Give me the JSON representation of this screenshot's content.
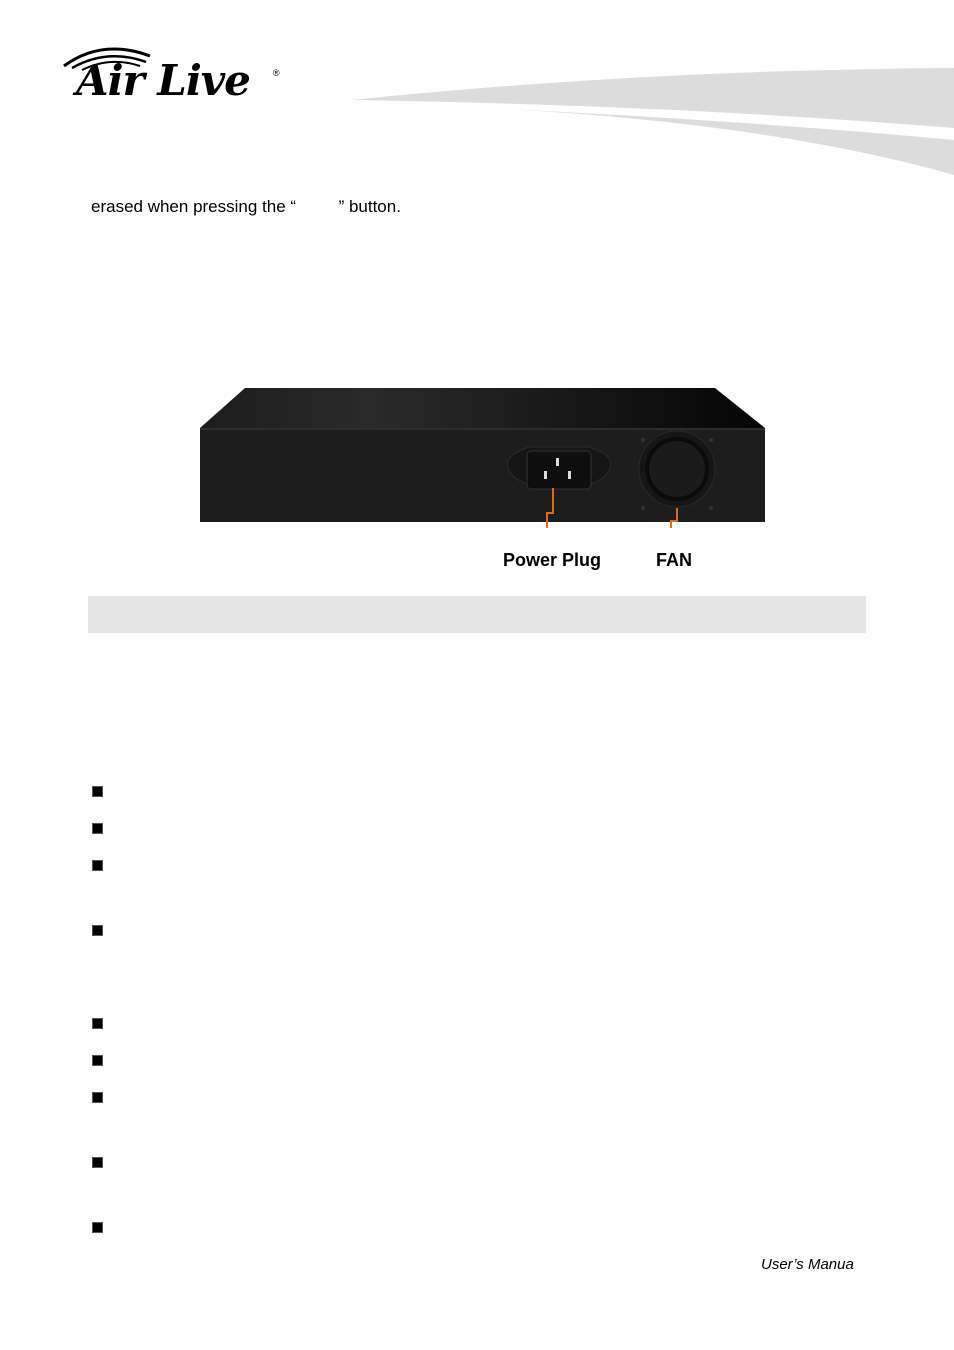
{
  "header": {
    "logo_text": "Air Live",
    "logo_registered": "®"
  },
  "body": {
    "intro_line": "erased when pressing the “         ” button."
  },
  "figure": {
    "callouts": [
      {
        "label": "Power Plug"
      },
      {
        "label": "FAN"
      }
    ],
    "accent_color": "#e06a1b",
    "device_color": "#1a1a1a"
  },
  "section_bar": {
    "color": "#e5e5e5",
    "title": ""
  },
  "bullets": [
    {
      "text": ""
    },
    {
      "text": ""
    },
    {
      "text": ""
    },
    {
      "text": ""
    },
    {
      "text": ""
    },
    {
      "text": ""
    },
    {
      "text": ""
    },
    {
      "text": ""
    },
    {
      "text": ""
    }
  ],
  "footer": {
    "text": "User’s Manua"
  }
}
